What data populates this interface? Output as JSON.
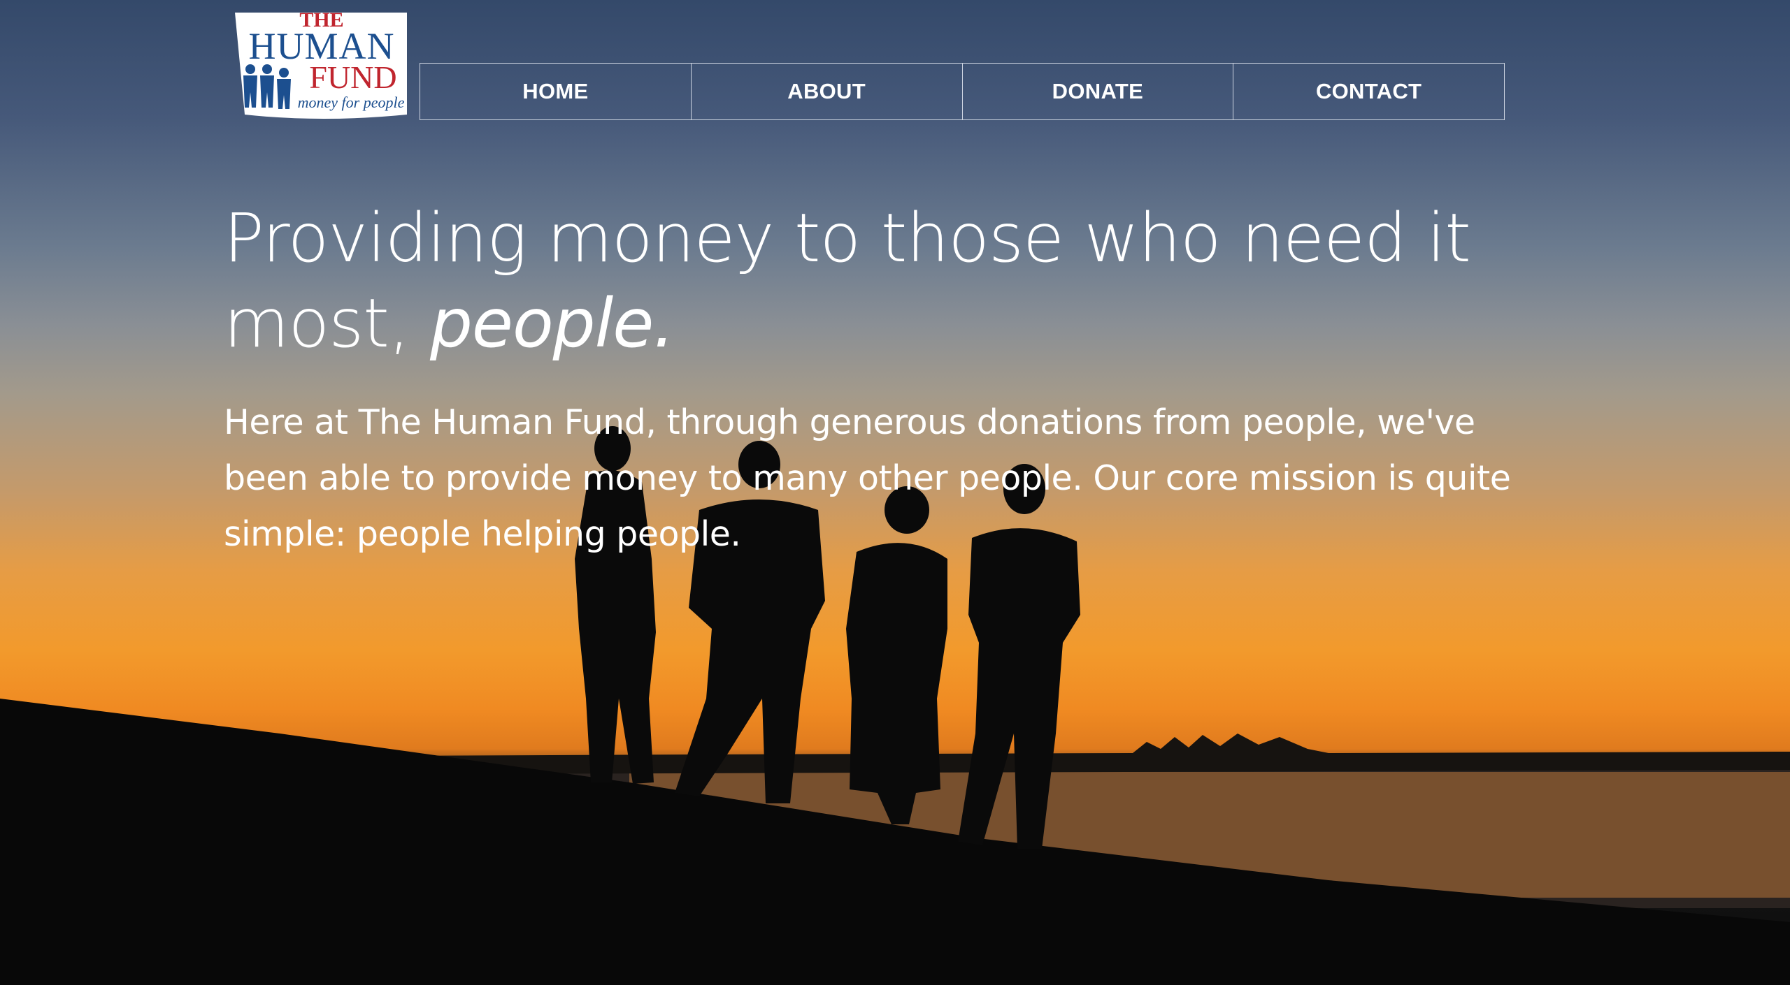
{
  "logo": {
    "line1": "THE",
    "line2": "HUMAN",
    "line3": "FUND",
    "tagline": "money for people"
  },
  "nav": {
    "items": [
      {
        "label": "HOME"
      },
      {
        "label": "ABOUT"
      },
      {
        "label": "DONATE"
      },
      {
        "label": "CONTACT"
      }
    ]
  },
  "hero": {
    "headline_main": "Providing money to those who need it most, ",
    "headline_emphasis": "people.",
    "body": "Here at The Human Fund, through generous donations from people, we've been able to provide money to many other people. Our core mission is quite simple: people helping people."
  },
  "colors": {
    "logo_blue": "#1c4f8f",
    "logo_red": "#c0252e",
    "text": "#ffffff",
    "nav_border": "#e6ebf5"
  },
  "icons": {
    "background": "sunset-silhouette-photo"
  }
}
